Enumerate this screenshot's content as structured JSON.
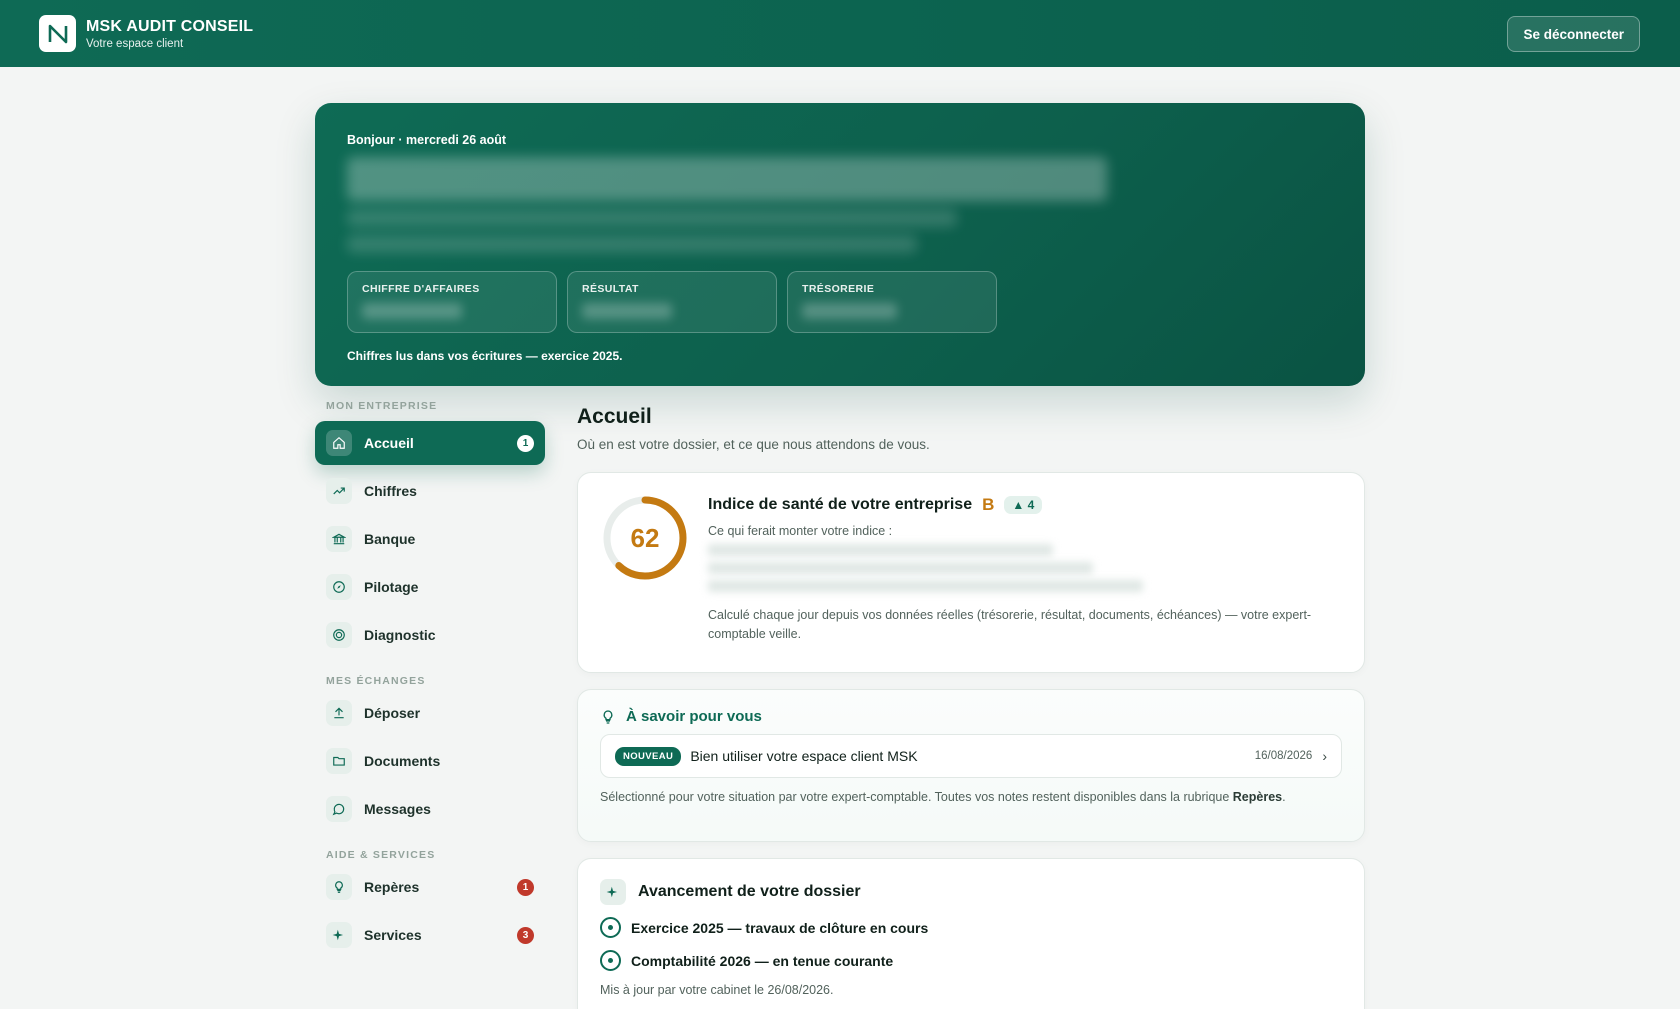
{
  "header": {
    "brand_name": "MSK AUDIT CONSEIL",
    "brand_sub": "Votre espace client",
    "logout_label": "Se déconnecter"
  },
  "hero": {
    "greeting": "Bonjour · mercredi 26 août",
    "kpis": [
      {
        "label": "CHIFFRE D'AFFAIRES"
      },
      {
        "label": "RÉSULTAT"
      },
      {
        "label": "TRÉSORERIE"
      }
    ],
    "note": "Chiffres lus dans vos écritures — exercice 2025."
  },
  "sidebar": {
    "sections": [
      {
        "title": "MON ENTREPRISE",
        "items": [
          {
            "label": "Accueil",
            "icon": "home-icon",
            "badge": "1",
            "active": true
          },
          {
            "label": "Chiffres",
            "icon": "trend-icon"
          },
          {
            "label": "Banque",
            "icon": "bank-icon"
          },
          {
            "label": "Pilotage",
            "icon": "compass-icon"
          },
          {
            "label": "Diagnostic",
            "icon": "target-icon"
          }
        ]
      },
      {
        "title": "MES ÉCHANGES",
        "items": [
          {
            "label": "Déposer",
            "icon": "upload-icon"
          },
          {
            "label": "Documents",
            "icon": "folder-icon"
          },
          {
            "label": "Messages",
            "icon": "chat-icon"
          }
        ]
      },
      {
        "title": "AIDE & SERVICES",
        "items": [
          {
            "label": "Repères",
            "icon": "bulb-icon",
            "badge": "1"
          },
          {
            "label": "Services",
            "icon": "sparkle-icon",
            "badge": "3"
          }
        ]
      }
    ]
  },
  "main": {
    "title": "Accueil",
    "subtitle": "Où en est votre dossier, et ce que nous attendons de vous.",
    "health": {
      "score": "62",
      "score_fraction": 0.62,
      "title": "Indice de santé de votre entreprise",
      "grade": "B",
      "trend": "▲ 4",
      "hint": "Ce qui ferait monter votre indice :",
      "footnote": "Calculé chaque jour depuis vos données réelles (trésorerie, résultat, documents, échéances) — votre expert-comptable veille.",
      "accent_color": "#c47a12"
    },
    "savoir": {
      "title": "À savoir pour vous",
      "pill": "NOUVEAU",
      "note_title": "Bien utiliser votre espace client MSK",
      "note_date": "16/08/2026",
      "footer_text": "Sélectionné pour votre situation par votre expert-comptable. Toutes vos notes restent disponibles dans la rubrique ",
      "footer_link": "Repères",
      "footer_end": "."
    },
    "avancement": {
      "title": "Avancement de votre dossier",
      "steps": [
        "Exercice 2025 — travaux de clôture en cours",
        "Comptabilité 2026 — en tenue courante"
      ],
      "footer": "Mis à jour par votre cabinet le 26/08/2026."
    }
  },
  "colors": {
    "brand": "#0e6a55",
    "alert": "#c0392b"
  }
}
